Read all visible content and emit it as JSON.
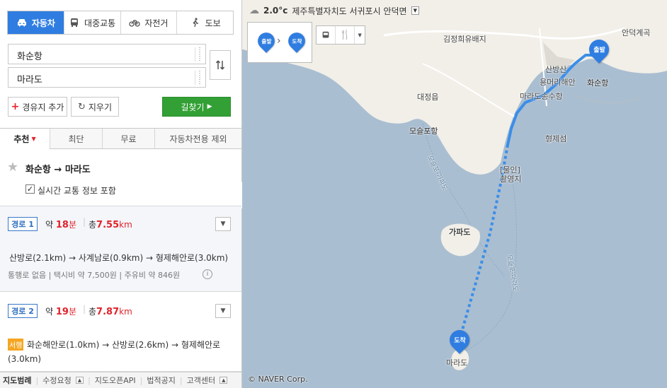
{
  "modes": [
    {
      "label": "자동차",
      "icon": "car-icon"
    },
    {
      "label": "대중교통",
      "icon": "bus-icon"
    },
    {
      "label": "자전거",
      "icon": "bicycle-icon"
    },
    {
      "label": "도보",
      "icon": "walk-icon"
    }
  ],
  "origin": "화순항",
  "destination": "마라도",
  "add_waypoint": "경유지 추가",
  "clear": "지우기",
  "find": "길찾기",
  "options": [
    "추천",
    "최단",
    "무료",
    "자동차전용 제외"
  ],
  "summary": {
    "title": "화순항 → 마라도",
    "checkbox_label": "실시간 교통 정보 포함",
    "checked": true
  },
  "routes": [
    {
      "badge": "경로 1",
      "time_prefix": "약 ",
      "time": "18",
      "time_unit": "분",
      "dist_prefix": "총",
      "dist": "7.55",
      "dist_unit": "km",
      "path": "산방로(2.1km) → 사계남로(0.9km) → 형제해안로(3.0km)",
      "info": "통행로 없음 | 택시비 약 7,500원 | 주유비 약 846원"
    },
    {
      "badge": "경로 2",
      "time_prefix": "약 ",
      "time": "19",
      "time_unit": "분",
      "dist_prefix": "총",
      "dist": "7.87",
      "dist_unit": "km",
      "tag": "서행",
      "path": "화순해안로(1.0km) → 산방로(2.6km) → 형제해안로",
      "path2": "(3.0km)"
    }
  ],
  "footer": [
    "지도범례",
    "수정요청",
    "지도오픈API",
    "법적공지",
    "고객센터"
  ],
  "weather": {
    "temp": "2.0°c",
    "location": "제주특별자치도 서귀포시 안덕면"
  },
  "legend": {
    "start": "출발",
    "end": "도착"
  },
  "map_labels": [
    "김정희유배지",
    "안덕계곡",
    "산방산",
    "용머리해안",
    "마라도송수항",
    "화순항",
    "대정읍",
    "모슬포항",
    "형제섬",
    "[물인]",
    "촬영지",
    "가파도",
    "마라도",
    "모슬포-가파도",
    "모슬포-마라도"
  ],
  "copyright": "© NAVER Corp.",
  "colors": {
    "accent": "#2f7de1",
    "find": "#33a035",
    "route": "#3b8ee8",
    "red": "#e0232a"
  }
}
